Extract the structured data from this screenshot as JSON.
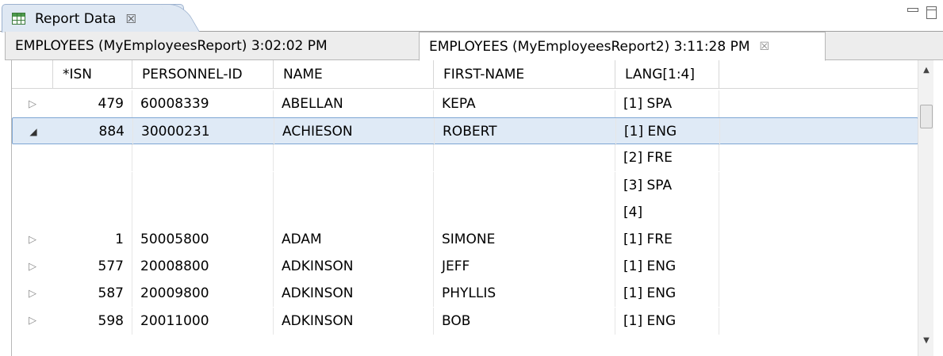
{
  "view_tab": {
    "title": "Report Data",
    "close": "☒"
  },
  "inner_tabs": [
    {
      "label": "EMPLOYEES (MyEmployeesReport) 3:02:02 PM"
    },
    {
      "label": "EMPLOYEES (MyEmployeesReport2) 3:11:28 PM",
      "close": "☒"
    }
  ],
  "table": {
    "headers": [
      "*ISN",
      "PERSONNEL-ID",
      "NAME",
      "FIRST-NAME",
      "LANG[1:4]"
    ],
    "rows": [
      {
        "expander": "▷",
        "isn": "479",
        "pid": "60008339",
        "name": "ABELLAN",
        "first": "KEPA",
        "lang": "[1]  SPA"
      },
      {
        "expander": "◢",
        "isn": "884",
        "pid": "30000231",
        "name": "ACHIESON",
        "first": "ROBERT",
        "lang": "[1]  ENG"
      },
      {
        "expander": "",
        "isn": "",
        "pid": "",
        "name": "",
        "first": "",
        "lang": "[2]  FRE"
      },
      {
        "expander": "",
        "isn": "",
        "pid": "",
        "name": "",
        "first": "",
        "lang": "[3]  SPA"
      },
      {
        "expander": "",
        "isn": "",
        "pid": "",
        "name": "",
        "first": "",
        "lang": "[4]"
      },
      {
        "expander": "▷",
        "isn": "1",
        "pid": "50005800",
        "name": "ADAM",
        "first": "SIMONE",
        "lang": "[1]  FRE"
      },
      {
        "expander": "▷",
        "isn": "577",
        "pid": "20008800",
        "name": "ADKINSON",
        "first": "JEFF",
        "lang": "[1]  ENG"
      },
      {
        "expander": "▷",
        "isn": "587",
        "pid": "20009800",
        "name": "ADKINSON",
        "first": "PHYLLIS",
        "lang": "[1]  ENG"
      },
      {
        "expander": "▷",
        "isn": "598",
        "pid": "20011000",
        "name": "ADKINSON",
        "first": "BOB",
        "lang": "[1]  ENG"
      }
    ]
  },
  "scrollbar": {
    "up": "▲",
    "down": "▼"
  }
}
